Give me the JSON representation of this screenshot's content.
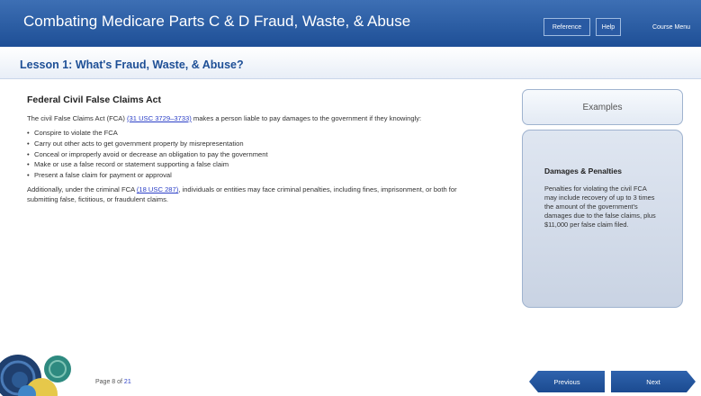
{
  "header": {
    "title": "Combating Medicare Parts C & D Fraud, Waste, & Abuse",
    "reference_label": "Reference",
    "help_label": "Help",
    "course_menu_label": "Course Menu"
  },
  "lesson": {
    "title": "Lesson 1: What's Fraud, Waste, & Abuse?"
  },
  "content": {
    "heading": "Federal Civil False Claims Act",
    "intro_before": "The civil False Claims Act (FCA) ",
    "intro_link": "(31 USC 3729–3733)",
    "intro_after": " makes a person liable to pay damages to the government if they knowingly:",
    "bullets": [
      "Conspire to violate the FCA",
      "Carry out other acts to get government property by misrepresentation",
      "Conceal or improperly avoid or decrease an obligation to pay the government",
      "Make or use a false record or statement supporting a false claim",
      "Present a false claim for payment or approval"
    ],
    "closing_before": "Additionally, under the criminal FCA ",
    "closing_link": "(18 USC 287)",
    "closing_after": ", individuals or entities may face criminal penalties, including fines, imprisonment, or both for submitting false, fictitious, or fraudulent claims."
  },
  "sidebar": {
    "examples_label": "Examples",
    "panel_title": "Damages & Penalties",
    "panel_body": "Penalties for violating the civil FCA may include recovery of up to 3 times the amount of the government's damages due to the false claims, plus $11,000 per false claim filed."
  },
  "footer": {
    "page_label": "Page 8 of ",
    "page_total": "21",
    "previous_label": "Previous",
    "next_label": "Next"
  }
}
